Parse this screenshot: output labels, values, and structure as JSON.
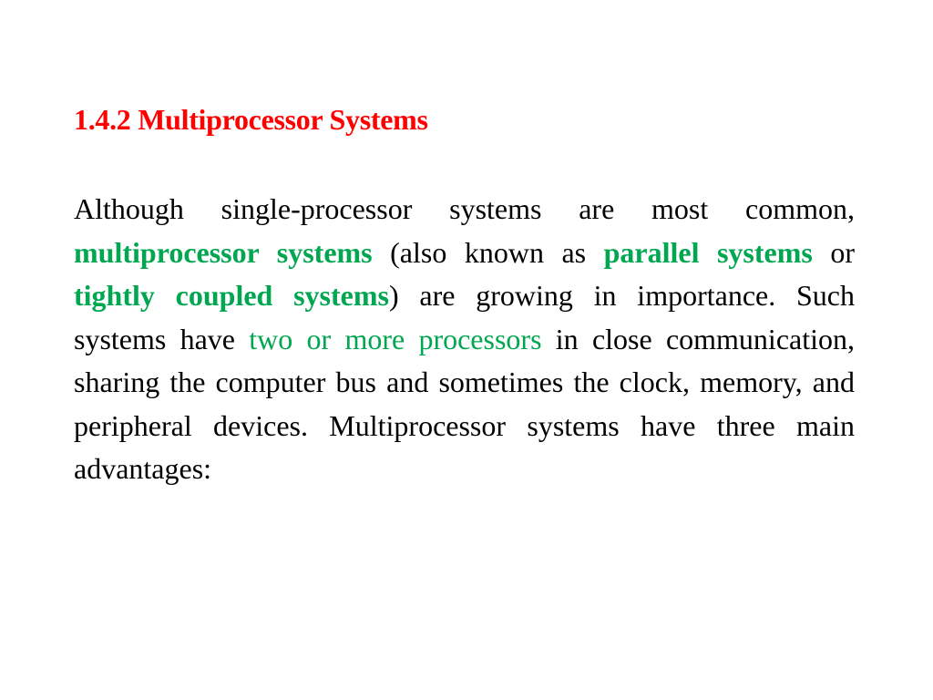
{
  "slide": {
    "title": "1.4.2 Multiprocessor Systems",
    "paragraph": {
      "t1": "Although single-processor systems are most common, ",
      "h1": "multiprocessor systems",
      "t2": " (also known as ",
      "h2": "parallel systems",
      "t3": " or ",
      "h3": "tightly coupled systems",
      "t4": ") are growing in importance. Such systems have ",
      "h4": "two or more processors",
      "t5": " in close communication, sharing the computer bus and sometimes the clock, memory, and peripheral devices. Multiprocessor systems have three main advantages:"
    },
    "colors": {
      "title": "#ff0000",
      "highlight": "#00a650",
      "text": "#000000"
    }
  }
}
